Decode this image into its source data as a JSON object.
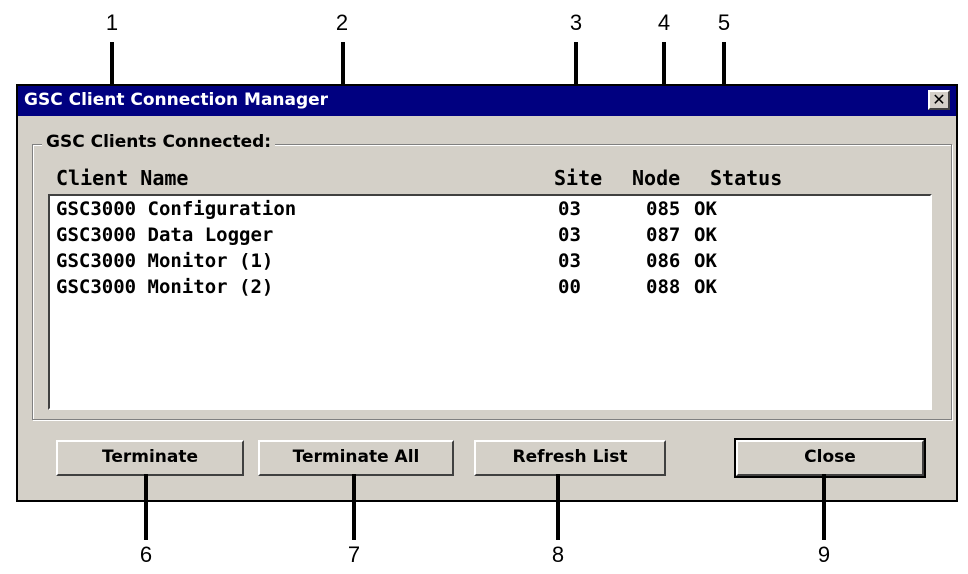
{
  "callouts": [
    "1",
    "2",
    "3",
    "4",
    "5",
    "6",
    "7",
    "8",
    "9"
  ],
  "window": {
    "title": "GSC Client Connection Manager",
    "close_glyph": "✕"
  },
  "group": {
    "label": "GSC Clients Connected:"
  },
  "columns": {
    "client_name": "Client Name",
    "site": "Site",
    "node": "Node",
    "status": "Status"
  },
  "rows": [
    {
      "name": "GSC3000 Configuration",
      "site": "03",
      "node": "085",
      "status": "OK"
    },
    {
      "name": "GSC3000 Data Logger",
      "site": "03",
      "node": "087",
      "status": "OK"
    },
    {
      "name": "GSC3000 Monitor (1)",
      "site": "03",
      "node": "086",
      "status": "OK"
    },
    {
      "name": "GSC3000 Monitor (2)",
      "site": "00",
      "node": "088",
      "status": "OK"
    }
  ],
  "buttons": {
    "terminate": "Terminate",
    "terminate_all": "Terminate All",
    "refresh": "Refresh List",
    "close": "Close"
  }
}
